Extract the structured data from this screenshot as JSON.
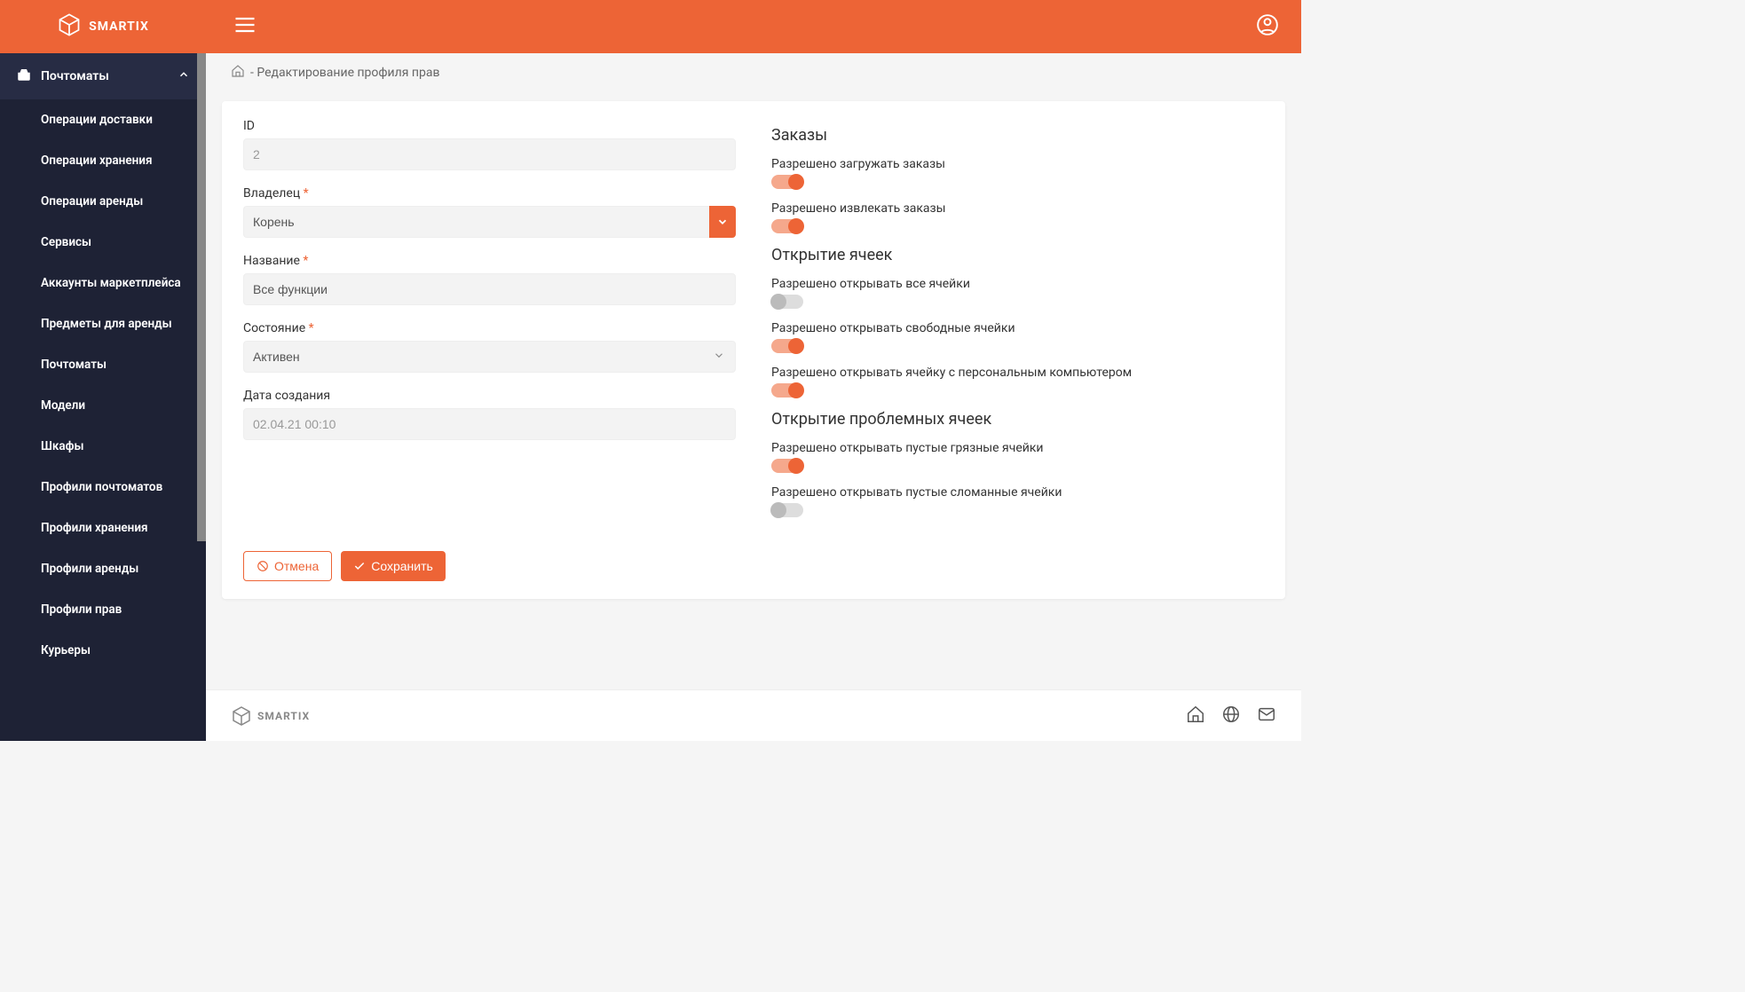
{
  "brand": "SMARTIX",
  "breadcrumb": "- Редактирование профиля прав",
  "sidebar": {
    "group_label": "Почтоматы",
    "items": [
      {
        "label": "Операции доставки"
      },
      {
        "label": "Операции хранения"
      },
      {
        "label": "Операции аренды"
      },
      {
        "label": "Сервисы"
      },
      {
        "label": "Аккаунты маркетплейса"
      },
      {
        "label": "Предметы для аренды"
      },
      {
        "label": "Почтоматы"
      },
      {
        "label": "Модели"
      },
      {
        "label": "Шкафы"
      },
      {
        "label": "Профили почтоматов"
      },
      {
        "label": "Профили хранения"
      },
      {
        "label": "Профили аренды"
      },
      {
        "label": "Профили прав"
      },
      {
        "label": "Курьеры"
      }
    ]
  },
  "form": {
    "id_label": "ID",
    "id_value": "2",
    "owner_label": "Владелец",
    "owner_value": "Корень",
    "name_label": "Название",
    "name_value": "Все функции",
    "state_label": "Состояние",
    "state_value": "Активен",
    "created_label": "Дата создания",
    "created_value": "02.04.21 00:10"
  },
  "sections": {
    "orders": {
      "title": "Заказы",
      "perm_load": {
        "label": "Разрешено загружать заказы",
        "on": true
      },
      "perm_extract": {
        "label": "Разрешено извлекать заказы",
        "on": true
      }
    },
    "open_cells": {
      "title": "Открытие ячеек",
      "perm_all": {
        "label": "Разрешено открывать все ячейки",
        "on": false
      },
      "perm_free": {
        "label": "Разрешено открывать свободные ячейки",
        "on": true
      },
      "perm_pc": {
        "label": "Разрешено открывать ячейку с персональным компьютером",
        "on": true
      }
    },
    "problem_cells": {
      "title": "Открытие проблемных ячеек",
      "perm_dirty": {
        "label": "Разрешено открывать пустые грязные ячейки",
        "on": true
      },
      "perm_broken": {
        "label": "Разрешено открывать пустые сломанные ячейки",
        "on": false
      }
    }
  },
  "actions": {
    "cancel": "Отмена",
    "save": "Сохранить"
  }
}
